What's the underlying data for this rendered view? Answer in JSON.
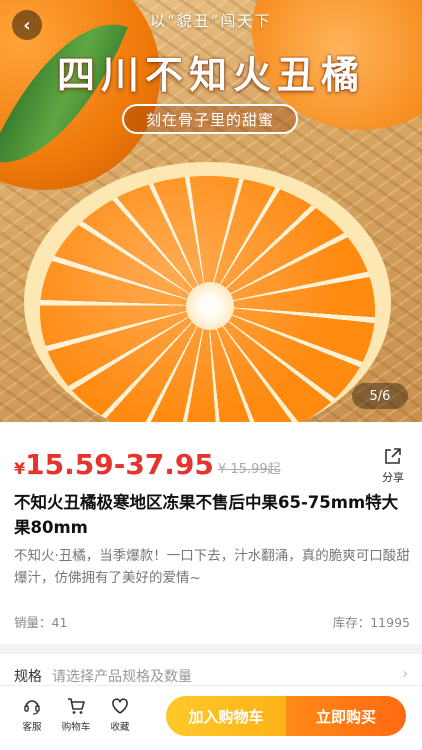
{
  "hero": {
    "slogan_top": "以“貌丑”闯天下",
    "title": "四川不知火丑橘",
    "subtitle": "刻在骨子里的甜蜜",
    "pager": "5/6"
  },
  "product": {
    "price_symbol": "¥",
    "price_range": "15.59-37.95",
    "original_price": "¥ 15.99起",
    "share_label": "分享",
    "title": "不知火丑橘极寒地区冻果不售后中果65-75mm特大果80mm",
    "description": "不知火·丑橘，当季爆款！一口下去，汁水翻涌，真的脆爽可口酸甜爆汁，仿佛拥有了美好的爱情~",
    "sales": "销量：41",
    "stock": "库存：11995"
  },
  "spec": {
    "label": "规格",
    "hint": "请选择产品规格及数量"
  },
  "bottom_bar": {
    "service_label": "客服",
    "cart_label": "购物车",
    "favorite_label": "收藏",
    "add_to_cart": "加入购物车",
    "buy_now": "立即购买"
  },
  "colors": {
    "price_red": "#e8322c",
    "cart_yellow": "#ffc928",
    "buy_orange": "#ff6a12"
  }
}
